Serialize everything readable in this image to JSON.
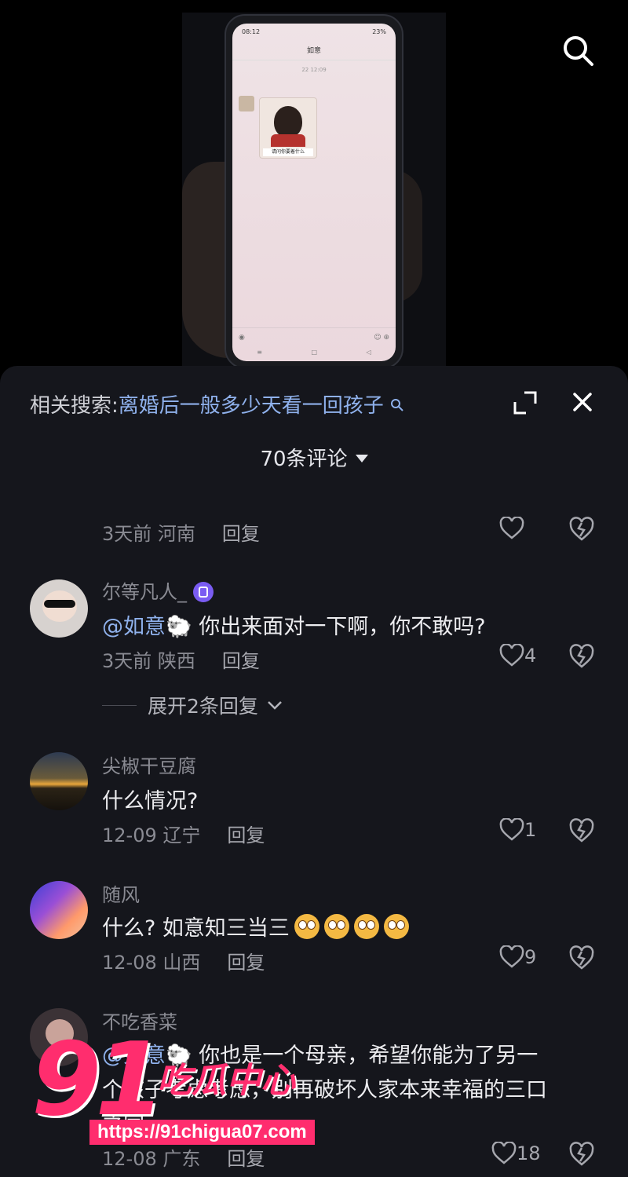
{
  "video": {
    "phone_status_time": "08:12",
    "phone_battery": "23%",
    "chat_title": "如意",
    "chat_time": "22 12:09",
    "sticker_caption": "请问你要着什么"
  },
  "related_search": {
    "prefix": "相关搜索:",
    "term": "离婚后一般多少天看一回孩子"
  },
  "comments_header": {
    "count_label": "70条评论"
  },
  "comments": [
    {
      "meta_time": "3天前",
      "meta_loc": "河南",
      "reply": "回复",
      "likes": ""
    },
    {
      "user": "尔等凡人_",
      "mention": "@如意",
      "text": " 你出来面对一下啊，你不敢吗?",
      "meta_time": "3天前",
      "meta_loc": "陕西",
      "reply": "回复",
      "likes": "4"
    },
    {
      "user": "尖椒干豆腐",
      "text": "什么情况?",
      "meta_time": "12-09",
      "meta_loc": "辽宁",
      "reply": "回复",
      "likes": "1"
    },
    {
      "user": "随风",
      "text": "什么? 如意知三当三",
      "meta_time": "12-08",
      "meta_loc": "山西",
      "reply": "回复",
      "likes": "9"
    },
    {
      "user": "不吃香菜",
      "mention": "@如意",
      "text_line1": " 你也是一个母亲，希望你能为了另一",
      "text_line2": "个孩子考虑考虑，别再破坏人家本来幸福的三口",
      "text_line3": "之家",
      "meta_time": "12-08",
      "meta_loc": "广东",
      "reply": "回复",
      "likes": "18"
    }
  ],
  "expand_replies": "展开2条回复",
  "watermark": {
    "num": "91",
    "cn": "吃瓜中心",
    "url": "https://91chigua07.com"
  },
  "colors": {
    "accent_link": "#8fb1ec",
    "sheet_bg": "#15161c",
    "watermark": "#ff2d6e"
  }
}
